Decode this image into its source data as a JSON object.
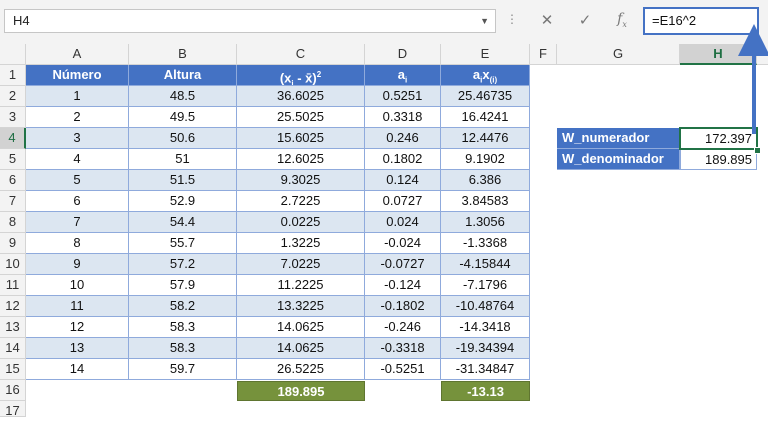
{
  "namebox": {
    "value": "H4"
  },
  "formula_bar": {
    "value": "=E16^2"
  },
  "columns": [
    "A",
    "B",
    "C",
    "D",
    "E",
    "F",
    "G",
    "H"
  ],
  "selected_column": "H",
  "selected_row": 4,
  "rows": [
    "1",
    "2",
    "3",
    "4",
    "5",
    "6",
    "7",
    "8",
    "9",
    "10",
    "11",
    "12",
    "13",
    "14",
    "15",
    "16",
    "17"
  ],
  "table": {
    "headers": {
      "numero": "Número",
      "altura": "Altura",
      "c_base": "(x",
      "c_i": "i",
      "c_mid": " - x̄)",
      "c_sup": "2",
      "d_base": "a",
      "d_sub": "i",
      "e_a": "a",
      "e_i": "i",
      "e_x": "x",
      "e_sub": "(i)"
    },
    "rows": [
      {
        "n": "1",
        "altura": "48.5",
        "sq": "36.6025",
        "a": "0.5251",
        "ax": "25.46735"
      },
      {
        "n": "2",
        "altura": "49.5",
        "sq": "25.5025",
        "a": "0.3318",
        "ax": "16.4241"
      },
      {
        "n": "3",
        "altura": "50.6",
        "sq": "15.6025",
        "a": "0.246",
        "ax": "12.4476"
      },
      {
        "n": "4",
        "altura": "51",
        "sq": "12.6025",
        "a": "0.1802",
        "ax": "9.1902"
      },
      {
        "n": "5",
        "altura": "51.5",
        "sq": "9.3025",
        "a": "0.124",
        "ax": "6.386"
      },
      {
        "n": "6",
        "altura": "52.9",
        "sq": "2.7225",
        "a": "0.0727",
        "ax": "3.84583"
      },
      {
        "n": "7",
        "altura": "54.4",
        "sq": "0.0225",
        "a": "0.024",
        "ax": "1.3056"
      },
      {
        "n": "8",
        "altura": "55.7",
        "sq": "1.3225",
        "a": "-0.024",
        "ax": "-1.3368"
      },
      {
        "n": "9",
        "altura": "57.2",
        "sq": "7.0225",
        "a": "-0.0727",
        "ax": "-4.15844"
      },
      {
        "n": "10",
        "altura": "57.9",
        "sq": "11.2225",
        "a": "-0.124",
        "ax": "-7.1796"
      },
      {
        "n": "11",
        "altura": "58.2",
        "sq": "13.3225",
        "a": "-0.1802",
        "ax": "-10.48764"
      },
      {
        "n": "12",
        "altura": "58.3",
        "sq": "14.0625",
        "a": "-0.246",
        "ax": "-14.3418"
      },
      {
        "n": "13",
        "altura": "58.3",
        "sq": "14.0625",
        "a": "-0.3318",
        "ax": "-19.34394"
      },
      {
        "n": "14",
        "altura": "59.7",
        "sq": "26.5225",
        "a": "-0.5251",
        "ax": "-31.34847"
      }
    ],
    "totals": {
      "sq": "189.895",
      "ax": "-13.13"
    }
  },
  "w": {
    "numerador_label": "W_numerador",
    "numerador_value": "172.397",
    "denominador_label": "W_denominador",
    "denominador_value": "189.895"
  },
  "colors": {
    "header": "#4472c4",
    "band": "#dce6f1",
    "total": "#76923c",
    "selection": "#217346",
    "arrow": "#4472c4"
  }
}
